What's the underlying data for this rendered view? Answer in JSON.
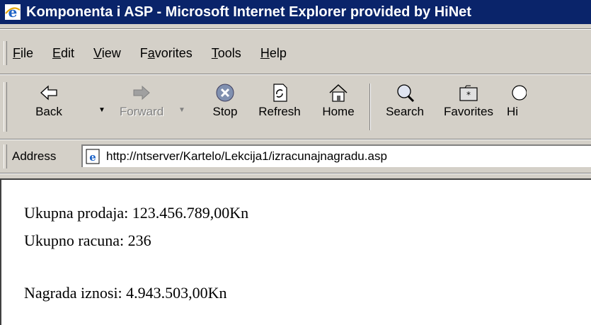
{
  "window": {
    "title": "Komponenta i ASP - Microsoft Internet Explorer provided by HiNet"
  },
  "menu": [
    {
      "label": "File",
      "u": "F"
    },
    {
      "label": "Edit",
      "u": "E"
    },
    {
      "label": "View",
      "u": "V"
    },
    {
      "label": "Favorites",
      "u": "a"
    },
    {
      "label": "Tools",
      "u": "T"
    },
    {
      "label": "Help",
      "u": "H"
    }
  ],
  "toolbar": {
    "back": "Back",
    "forward": "Forward",
    "stop": "Stop",
    "refresh": "Refresh",
    "home": "Home",
    "search": "Search",
    "favorites": "Favorites",
    "history": "Hi"
  },
  "address": {
    "label": "Address",
    "url": "http://ntserver/Kartelo/Lekcija1/izracunajnagradu.asp"
  },
  "page": {
    "line1": "Ukupna prodaja: 123.456.789,00Kn",
    "line2": "Ukupno racuna: 236",
    "line3": "Nagrada iznosi: 4.943.503,00Kn"
  }
}
